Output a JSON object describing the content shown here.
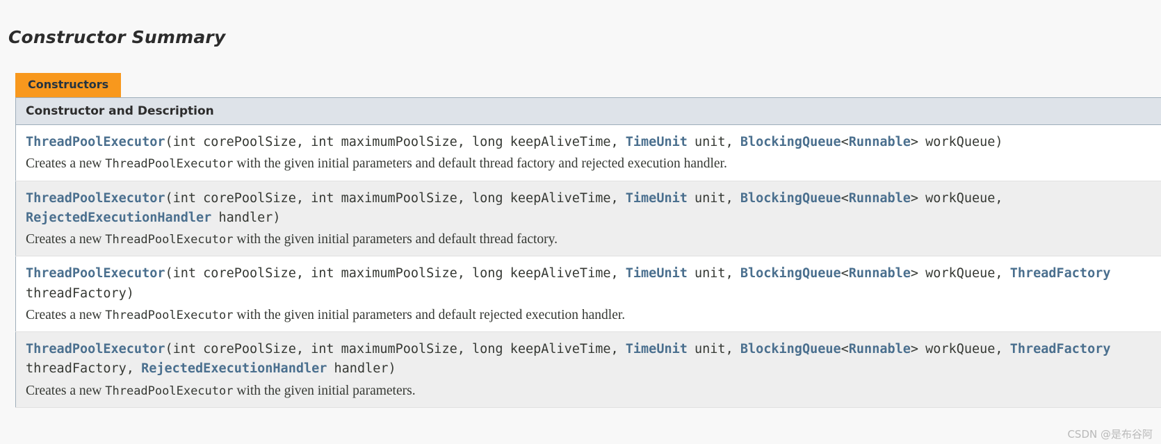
{
  "page": {
    "section_title": "Constructor Summary",
    "watermark": "CSDN @是布谷阿"
  },
  "colors": {
    "tab_background": "#f8981d",
    "column_header_background": "#dee3e9",
    "link": "#4a6f8e",
    "text": "#353833",
    "row_alt_background": "#eeeeee",
    "row_background": "#ffffff",
    "page_background": "#f8f8f8",
    "watermark": "#b9b9b9"
  },
  "table": {
    "tab_label": "Constructors",
    "column_header": "Constructor and Description",
    "rows": [
      {
        "signature_segments": [
          {
            "text": "ThreadPoolExecutor",
            "kind": "link"
          },
          {
            "text": "(int corePoolSize, int maximumPoolSize, long keepAliveTime, ",
            "kind": "plain"
          },
          {
            "text": "TimeUnit",
            "kind": "link"
          },
          {
            "text": " unit, ",
            "kind": "plain"
          },
          {
            "text": "BlockingQueue",
            "kind": "link"
          },
          {
            "text": "<",
            "kind": "plain"
          },
          {
            "text": "Runnable",
            "kind": "link"
          },
          {
            "text": "> workQueue)",
            "kind": "plain"
          }
        ],
        "description_segments": [
          {
            "text": "Creates a new ",
            "kind": "text"
          },
          {
            "text": "ThreadPoolExecutor",
            "kind": "code"
          },
          {
            "text": " with the given initial parameters and default thread factory and rejected execution handler.",
            "kind": "text"
          }
        ]
      },
      {
        "signature_segments": [
          {
            "text": "ThreadPoolExecutor",
            "kind": "link"
          },
          {
            "text": "(int corePoolSize, int maximumPoolSize, long keepAliveTime, ",
            "kind": "plain"
          },
          {
            "text": "TimeUnit",
            "kind": "link"
          },
          {
            "text": " unit, ",
            "kind": "plain"
          },
          {
            "text": "BlockingQueue",
            "kind": "link"
          },
          {
            "text": "<",
            "kind": "plain"
          },
          {
            "text": "Runnable",
            "kind": "link"
          },
          {
            "text": "> workQueue, ",
            "kind": "plain"
          },
          {
            "text": "RejectedExecutionHandler",
            "kind": "link"
          },
          {
            "text": " handler)",
            "kind": "plain"
          }
        ],
        "description_segments": [
          {
            "text": "Creates a new ",
            "kind": "text"
          },
          {
            "text": "ThreadPoolExecutor",
            "kind": "code"
          },
          {
            "text": " with the given initial parameters and default thread factory.",
            "kind": "text"
          }
        ]
      },
      {
        "signature_segments": [
          {
            "text": "ThreadPoolExecutor",
            "kind": "link"
          },
          {
            "text": "(int corePoolSize, int maximumPoolSize, long keepAliveTime, ",
            "kind": "plain"
          },
          {
            "text": "TimeUnit",
            "kind": "link"
          },
          {
            "text": " unit, ",
            "kind": "plain"
          },
          {
            "text": "BlockingQueue",
            "kind": "link"
          },
          {
            "text": "<",
            "kind": "plain"
          },
          {
            "text": "Runnable",
            "kind": "link"
          },
          {
            "text": "> workQueue, ",
            "kind": "plain"
          },
          {
            "text": "ThreadFactory",
            "kind": "link"
          },
          {
            "text": " threadFactory)",
            "kind": "plain"
          }
        ],
        "description_segments": [
          {
            "text": "Creates a new ",
            "kind": "text"
          },
          {
            "text": "ThreadPoolExecutor",
            "kind": "code"
          },
          {
            "text": " with the given initial parameters and default rejected execution handler.",
            "kind": "text"
          }
        ]
      },
      {
        "signature_segments": [
          {
            "text": "ThreadPoolExecutor",
            "kind": "link"
          },
          {
            "text": "(int corePoolSize, int maximumPoolSize, long keepAliveTime, ",
            "kind": "plain"
          },
          {
            "text": "TimeUnit",
            "kind": "link"
          },
          {
            "text": " unit, ",
            "kind": "plain"
          },
          {
            "text": "BlockingQueue",
            "kind": "link"
          },
          {
            "text": "<",
            "kind": "plain"
          },
          {
            "text": "Runnable",
            "kind": "link"
          },
          {
            "text": "> workQueue, ",
            "kind": "plain"
          },
          {
            "text": "ThreadFactory",
            "kind": "link"
          },
          {
            "text": " threadFactory, ",
            "kind": "plain"
          },
          {
            "text": "RejectedExecutionHandler",
            "kind": "link"
          },
          {
            "text": " handler)",
            "kind": "plain"
          }
        ],
        "description_segments": [
          {
            "text": "Creates a new ",
            "kind": "text"
          },
          {
            "text": "ThreadPoolExecutor",
            "kind": "code"
          },
          {
            "text": " with the given initial parameters.",
            "kind": "text"
          }
        ]
      }
    ]
  }
}
